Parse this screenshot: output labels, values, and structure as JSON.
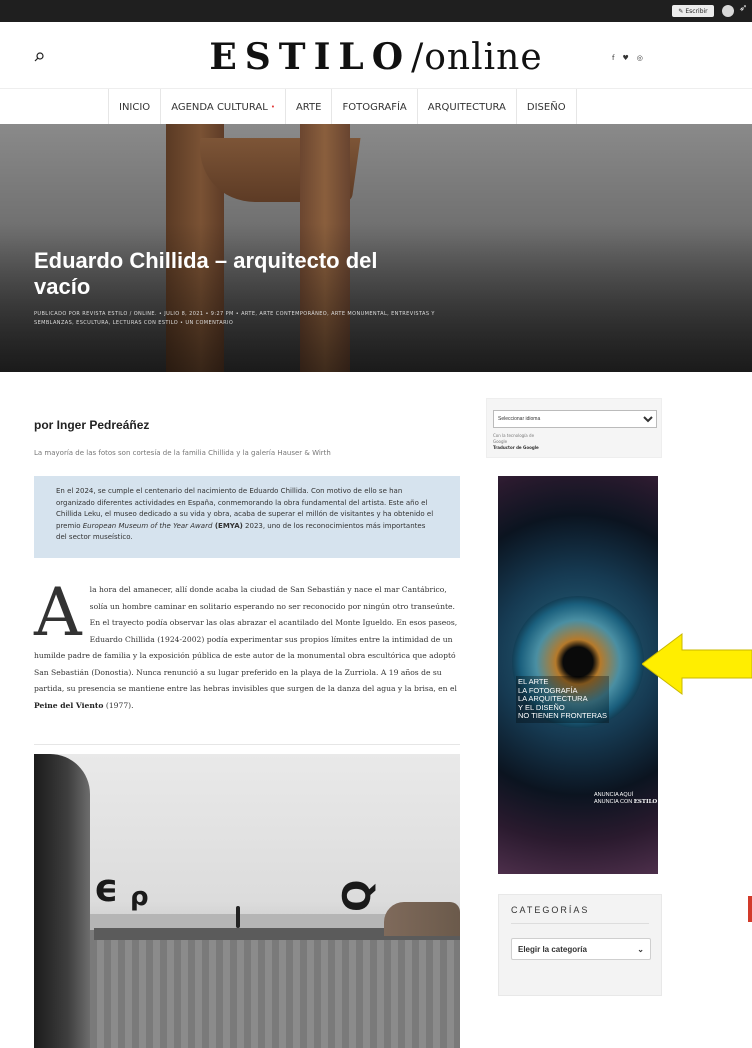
{
  "admin_bar": {
    "write_label": "Escribir",
    "write_icon": "pencil-icon",
    "rocket_icon": "rocket-icon"
  },
  "header": {
    "logo_part1": "ESTILO",
    "logo_slash": "/",
    "logo_part2": "online",
    "search_icon": "search-icon",
    "social": [
      "f",
      "♥",
      "◎"
    ]
  },
  "nav": {
    "items": [
      "INICIO",
      "AGENDA CULTURAL",
      "ARTE",
      "FOTOGRAFÍA",
      "ARQUITECTURA",
      "DISEÑO"
    ],
    "agenda_dot": "•"
  },
  "hero": {
    "title": "Eduardo Chillida – arquitecto del vacío",
    "meta": "PUBLICADO POR REVISTA ESTILO / ONLINE. • JULIO 8, 2021 • 9:27 PM • ARTE, ARTE CONTEMPORÁNEO, ARTE MONUMENTAL, ENTREVISTAS Y SEMBLANZAS, ESCULTURA, LECTURAS CON ESTILO • UN COMENTARIO"
  },
  "article": {
    "byline": "por Inger Pedreáñez",
    "caption": "La mayoría de las fotos son cortesía de la familia Chillida y la galería Hauser & Wirth",
    "box_text_1": "En el 2024, se cumple el centenario del nacimiento de Eduardo Chillida. Con motivo de ello se han organizado diferentes actividades en España, conmemorando la obra fundamental del artista. Este año el Chillida Leku, el museo dedicado a su vida y obra, acaba de superar el millón de visitantes y ha obtenido el premio ",
    "box_text_em": "European Museum of the Year Award",
    "box_text_bold": " (EMYA)",
    "box_text_2": " 2023, uno de los reconocimientos más importantes del sector museístico.",
    "dropcap": "A",
    "body_1": " la hora del amanecer, allí donde acaba la ciudad de San Sebastián y nace el mar Cantábrico, solía un hombre caminar en solitario esperando no ser reconocido por ningún otro transeúnte. En el trayecto podía observar las olas abrazar el acantilado del Monte Igueldo. En esos paseos, Eduardo Chillida (1924-2002) podía experimentar sus propios límites entre la intimidad de un humilde padre de familia y la exposición pública de este autor de la monumental obra escultórica que adoptó San Sebastián (Donostia). Nunca renunció a su lugar preferido en la playa de la Zurriola. A 19 años de su partida, su presencia se mantiene entre las hebras invisibles que surgen de la danza del agua y la brisa, en el ",
    "body_bold": "Peine del Viento",
    "body_2": " (1977)."
  },
  "sidebar": {
    "lang_select": "Seleccionar idioma",
    "powered_1": "Con la tecnología de",
    "powered_2": "Google",
    "powered_3": "Traductor de Google",
    "ad_lines": [
      "EL ARTE",
      "LA FOTOGRAFÍA",
      "LA ARQUITECTURA",
      "Y EL DISEÑO",
      "NO TIENEN FRONTERAS"
    ],
    "ad_cta_1": "ANUNCIA AQUÍ",
    "ad_cta_2": "ANUNCIA CON ",
    "ad_cta_brand": "ESTILO",
    "categories_title": "CATEGORÍAS",
    "categories_select": "Elegir la categoría"
  },
  "colors": {
    "accent_red": "#e23b3b",
    "info_box": "#d6e3ee",
    "arrow_yellow": "#ffee00"
  }
}
